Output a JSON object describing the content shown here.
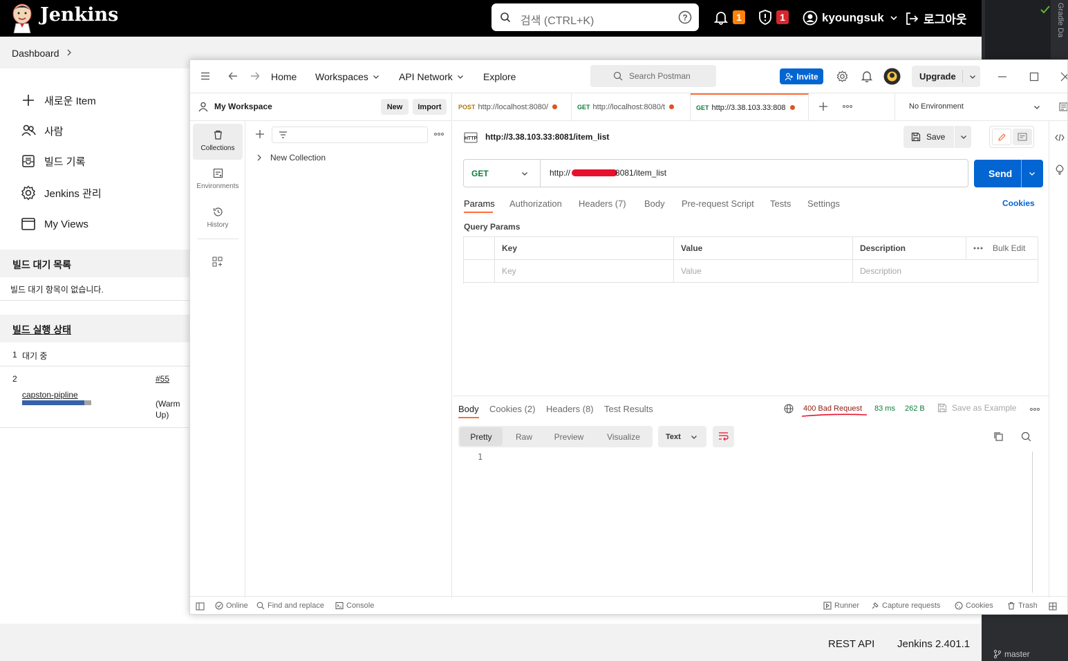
{
  "jenkins": {
    "title": "Jenkins",
    "search_placeholder": "검색 (CTRL+K)",
    "notifications_count": "1",
    "security_count": "1",
    "username": "kyoungsuk",
    "logout_label": "로그아웃",
    "breadcrumb": "Dashboard",
    "tasks": [
      "새로운 Item",
      "사람",
      "빌드 기록",
      "Jenkins 관리",
      "My Views"
    ],
    "build_queue": {
      "title": "빌드 대기 목록",
      "empty_message": "빌드 대기 항목이 없습니다."
    },
    "executors": {
      "title": "빌드 실행 상태",
      "row1_num": "1",
      "row1_status": "대기 중",
      "row2_num": "2",
      "row2_job": "capston-pipline",
      "row2_build": "#55",
      "row2_note": "(Warm Up)",
      "progress": 0.9
    },
    "footer": {
      "rest_api": "REST API",
      "version": "Jenkins 2.401.1"
    }
  },
  "ide": {
    "vertical_label": "Gradle  Da",
    "branch": "master"
  },
  "postman": {
    "nav": {
      "home": "Home",
      "workspaces": "Workspaces",
      "api_network": "API Network",
      "explore": "Explore"
    },
    "search_placeholder": "Search Postman",
    "invite_label": "Invite",
    "upgrade_label": "Upgrade",
    "workspace_name": "My Workspace",
    "new_label": "New",
    "import_label": "Import",
    "rail": [
      "Collections",
      "Environments",
      "History"
    ],
    "collection_name": "New Collection",
    "tabs": [
      {
        "method": "POST",
        "url": "http://localhost:8080/"
      },
      {
        "method": "GET",
        "url": "http://localhost:8080/t"
      },
      {
        "method": "GET",
        "url": "http://3.38.103.33:808"
      }
    ],
    "environment": "No Environment",
    "request_title": "http://3.38.103.33:8081/item_list",
    "save_label": "Save",
    "method": "GET",
    "url_prefix": "http://",
    "url_suffix": "8081/item_list",
    "send_label": "Send",
    "request_tabs": [
      "Params",
      "Authorization",
      "Headers (7)",
      "Body",
      "Pre-request Script",
      "Tests",
      "Settings"
    ],
    "cookies_label": "Cookies",
    "query_params_label": "Query Params",
    "table_headers": [
      "Key",
      "Value",
      "Description"
    ],
    "bulk_edit_label": "Bulk Edit",
    "table_placeholders": [
      "Key",
      "Value",
      "Description"
    ],
    "response_tabs": [
      "Body",
      "Cookies (2)",
      "Headers (8)",
      "Test Results"
    ],
    "status": "400 Bad Request",
    "time": "83 ms",
    "size": "262 B",
    "save_example_label": "Save as Example",
    "view_modes": [
      "Pretty",
      "Raw",
      "Preview",
      "Visualize"
    ],
    "format": "Text",
    "line_number": "1",
    "statusbar": {
      "online": "Online",
      "find_replace": "Find and replace",
      "console": "Console",
      "runner": "Runner",
      "capture": "Capture requests",
      "cookies": "Cookies",
      "trash": "Trash"
    }
  },
  "colors": {
    "jenkins_header": "#000000",
    "postman_orange": "#ff6c37",
    "send_blue": "#0265d2",
    "invite_blue": "#0265d2",
    "status_green": "#0d7d3a",
    "error_red": "#d8262e",
    "badge_orange": "#fe820a"
  }
}
